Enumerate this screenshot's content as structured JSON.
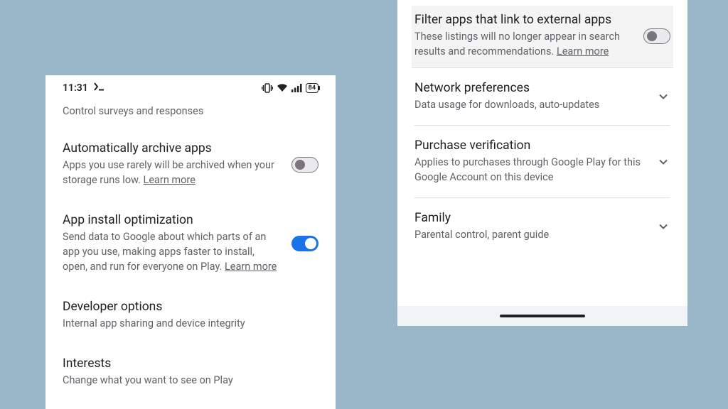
{
  "status_bar": {
    "time": "11:31",
    "battery_pct": "84"
  },
  "learn_more": "Learn more",
  "left": {
    "partial_top_sub": "Control surveys and responses",
    "archive": {
      "title": "Automatically archive apps",
      "sub_before": "Apps you use rarely will be archived when your storage runs low. ",
      "toggle_on": false
    },
    "optimize": {
      "title": "App install optimization",
      "sub_before": "Send data to Google about which parts of an app you use, making apps faster to install, open, and run for everyone on Play. ",
      "toggle_on": true
    },
    "devopts": {
      "title": "Developer options",
      "sub": "Internal app sharing and device integrity"
    },
    "interests": {
      "title": "Interests",
      "sub": "Change what you want to see on Play"
    }
  },
  "right": {
    "filter": {
      "title": "Filter apps that link to external apps",
      "sub_before": "These listings will no longer appear in search results and recommendations. ",
      "toggle_on": false
    },
    "network": {
      "title": "Network preferences",
      "sub": "Data usage for downloads, auto-updates"
    },
    "purchase": {
      "title": "Purchase verification",
      "sub": "Applies to purchases through Google Play for this Google Account on this device"
    },
    "family": {
      "title": "Family",
      "sub": "Parental control, parent guide"
    }
  }
}
